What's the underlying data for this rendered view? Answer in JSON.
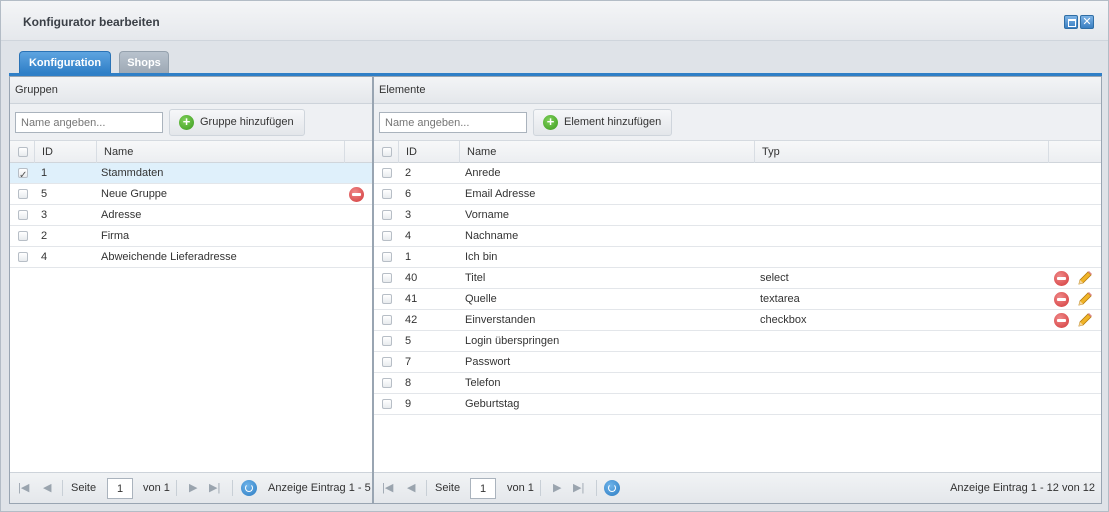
{
  "window": {
    "title": "Konfigurator bearbeiten"
  },
  "tabs": [
    {
      "label": "Konfiguration"
    },
    {
      "label": "Shops"
    }
  ],
  "groups": {
    "header": "Gruppen",
    "search_placeholder": "Name angeben...",
    "add_label": "Gruppe hinzufügen",
    "columns": {
      "id": "ID",
      "name": "Name"
    },
    "rows": [
      {
        "id": "1",
        "name": "Stammdaten"
      },
      {
        "id": "5",
        "name": "Neue Gruppe"
      },
      {
        "id": "3",
        "name": "Adresse"
      },
      {
        "id": "2",
        "name": "Firma"
      },
      {
        "id": "4",
        "name": "Abweichende Lieferadresse"
      }
    ],
    "pager": {
      "page_label": "Seite",
      "page": "1",
      "of_label": "von 1",
      "info": "Anzeige Eintrag 1 - 5"
    }
  },
  "elements": {
    "header": "Elemente",
    "search_placeholder": "Name angeben...",
    "add_label": "Element hinzufügen",
    "columns": {
      "id": "ID",
      "name": "Name",
      "type": "Typ"
    },
    "rows": [
      {
        "id": "2",
        "name": "Anrede",
        "type": ""
      },
      {
        "id": "6",
        "name": "Email Adresse",
        "type": ""
      },
      {
        "id": "3",
        "name": "Vorname",
        "type": ""
      },
      {
        "id": "4",
        "name": "Nachname",
        "type": ""
      },
      {
        "id": "1",
        "name": "Ich bin",
        "type": ""
      },
      {
        "id": "40",
        "name": "Titel",
        "type": "select"
      },
      {
        "id": "41",
        "name": "Quelle",
        "type": "textarea"
      },
      {
        "id": "42",
        "name": "Einverstanden",
        "type": "checkbox"
      },
      {
        "id": "5",
        "name": "Login überspringen",
        "type": ""
      },
      {
        "id": "7",
        "name": "Passwort",
        "type": ""
      },
      {
        "id": "8",
        "name": "Telefon",
        "type": ""
      },
      {
        "id": "9",
        "name": "Geburtstag",
        "type": ""
      }
    ],
    "pager": {
      "page_label": "Seite",
      "page": "1",
      "of_label": "von 1",
      "info": "Anzeige Eintrag 1 - 12 von 12"
    }
  },
  "colors": {
    "accent": "#2f7fc7",
    "add": "#3b9a1e",
    "delete": "#d2393a",
    "edit": "#e8a317"
  }
}
